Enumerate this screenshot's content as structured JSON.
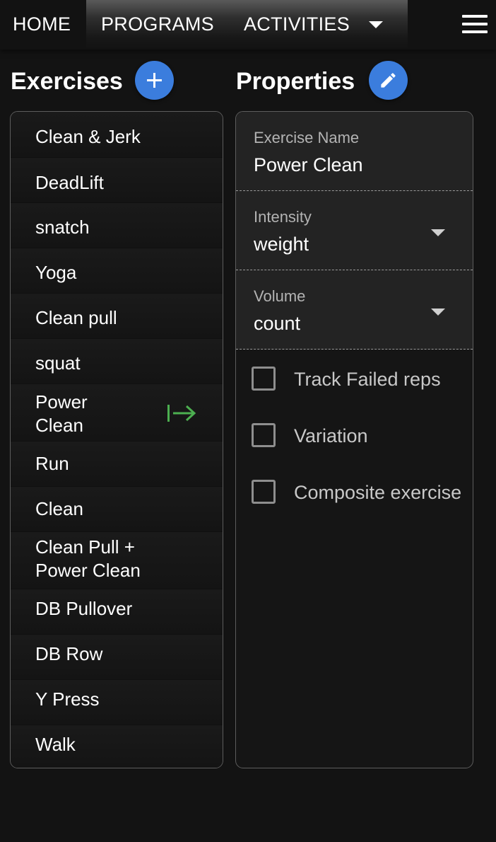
{
  "nav": {
    "home": "HOME",
    "programs": "PROGRAMS",
    "activities": "ACTIVITIES"
  },
  "exercises": {
    "title": "Exercises",
    "items": [
      {
        "label": "Clean & Jerk"
      },
      {
        "label": "DeadLift"
      },
      {
        "label": "snatch"
      },
      {
        "label": "Yoga"
      },
      {
        "label": "Clean pull"
      },
      {
        "label": "squat"
      },
      {
        "label": "Power\nClean",
        "selected": true
      },
      {
        "label": "Run"
      },
      {
        "label": "Clean"
      },
      {
        "label": "Clean Pull +\nPower Clean"
      },
      {
        "label": "DB Pullover"
      },
      {
        "label": "DB Row"
      },
      {
        "label": "Y Press"
      },
      {
        "label": "Walk"
      }
    ]
  },
  "properties": {
    "title": "Properties",
    "exercise_name": {
      "label": "Exercise Name",
      "value": "Power Clean"
    },
    "intensity": {
      "label": "Intensity",
      "value": "weight"
    },
    "volume": {
      "label": "Volume",
      "value": "count"
    },
    "checkboxes": [
      {
        "label": "Track Failed reps",
        "checked": false
      },
      {
        "label": "Variation",
        "checked": false
      },
      {
        "label": "Composite exercise",
        "checked": false
      }
    ]
  },
  "colors": {
    "accent": "#3b7ddd",
    "selected_icon": "#4caf50",
    "background": "#131313"
  },
  "icons": {
    "add": "plus-icon",
    "edit": "pencil-icon",
    "menu": "hamburger-icon",
    "goto": "arrow-to-right-icon"
  }
}
